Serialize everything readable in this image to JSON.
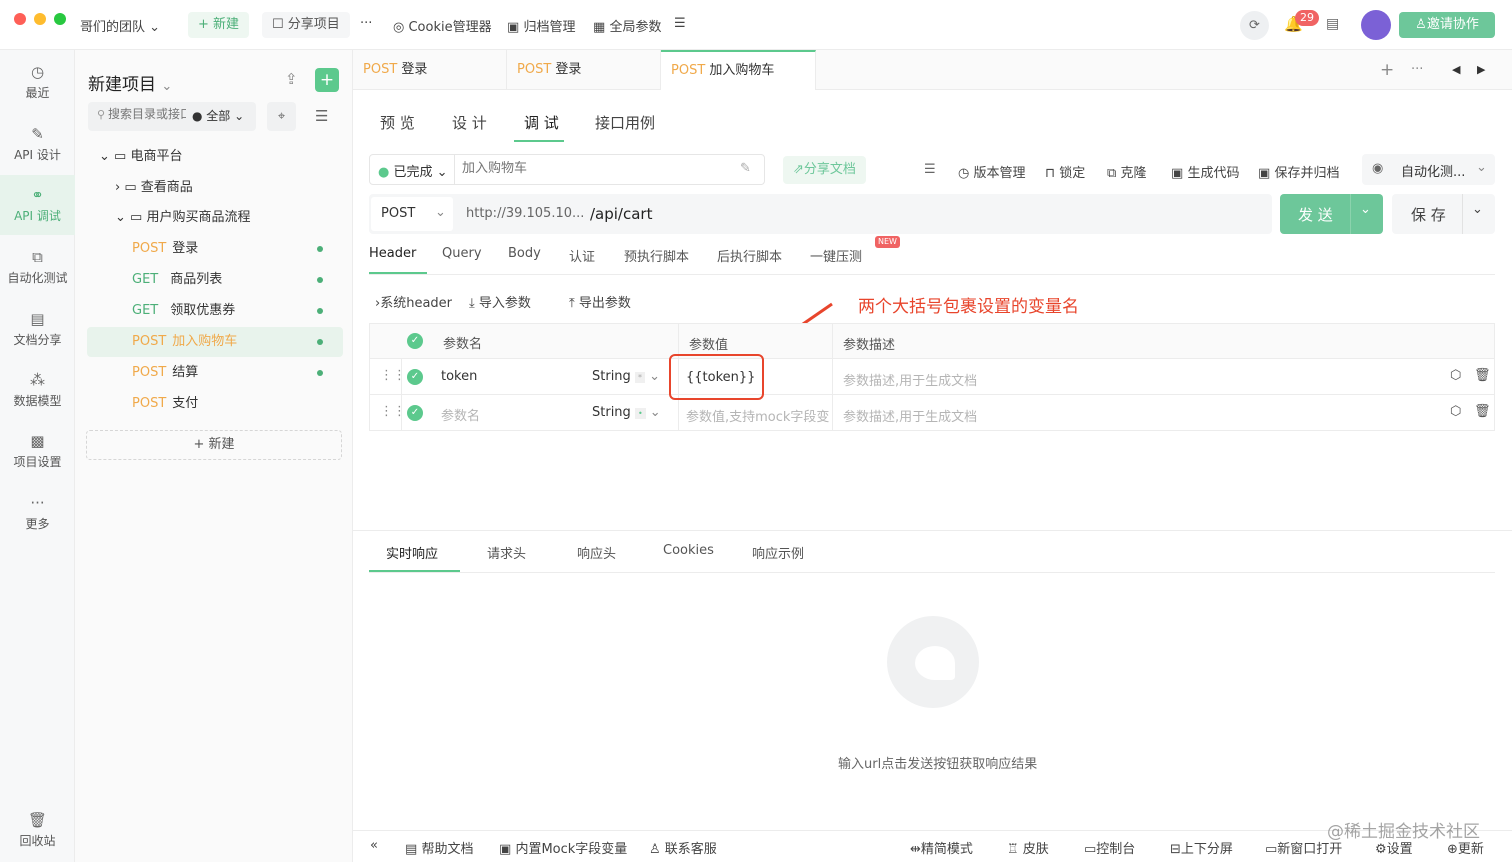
{
  "topbar": {
    "team": "哥们的团队",
    "new": "新建",
    "share_project": "分享项目",
    "more": "···",
    "cookie": "Cookie管理器",
    "archive": "归档管理",
    "global_params": "全局参数",
    "notif_count": "29",
    "invite": "邀请协作"
  },
  "nav": {
    "recent": "最近",
    "api_design": "API 设计",
    "api_debug": "API 调试",
    "auto_test": "自动化测试",
    "doc_share": "文档分享",
    "data_model": "数据模型",
    "project_settings": "项目设置",
    "more": "更多",
    "trash": "回收站"
  },
  "tree": {
    "project": "新建项目",
    "search_placeholder": "搜索目录或接口",
    "filter": "全部",
    "root": "电商平台",
    "folder1": "查看商品",
    "folder2": "用户购买商品流程",
    "items": [
      {
        "method": "POST",
        "name": "登录"
      },
      {
        "method": "GET",
        "name": "商品列表"
      },
      {
        "method": "GET",
        "name": "领取优惠券"
      },
      {
        "method": "POST",
        "name": "加入购物车"
      },
      {
        "method": "POST",
        "name": "结算"
      },
      {
        "method": "POST",
        "name": "支付"
      }
    ],
    "new_button": "新建"
  },
  "tabs": [
    {
      "method": "POST",
      "name": "登录"
    },
    {
      "method": "POST",
      "name": "登录"
    },
    {
      "method": "POST",
      "name": "加入购物车"
    }
  ],
  "subtabs": {
    "preview": "预 览",
    "design": "设 计",
    "debug": "调 试",
    "cases": "接口用例"
  },
  "toolbar": {
    "status": "已完成",
    "name_placeholder": "加入购物车",
    "share_doc": "分享文档",
    "version": "版本管理",
    "lock": "锁定",
    "clone": "克隆",
    "gen_code": "生成代码",
    "save_archive": "保存并归档",
    "auto": "自动化测..."
  },
  "request": {
    "method": "POST",
    "base_url": "http://39.105.10...",
    "path": "/api/cart",
    "send": "发 送",
    "save": "保 存"
  },
  "reqtabs": {
    "header": "Header",
    "query": "Query",
    "body": "Body",
    "auth": "认证",
    "pre": "预执行脚本",
    "post": "后执行脚本",
    "stress": "一键压测",
    "new_badge": "NEW"
  },
  "params_toolbar": {
    "sys_header": "系统header",
    "import": "导入参数",
    "export": "导出参数"
  },
  "annotation": "两个大括号包裹设置的变量名",
  "table": {
    "col_name": "参数名",
    "col_value": "参数值",
    "col_desc": "参数描述",
    "rows": [
      {
        "name": "token",
        "type": "String",
        "value": "{{token}}",
        "desc_placeholder": "参数描述,用于生成文档"
      }
    ],
    "new_row": {
      "name_placeholder": "参数名",
      "type": "String",
      "value_placeholder": "参数值,支持mock字段变量",
      "desc_placeholder": "参数描述,用于生成文档"
    }
  },
  "response": {
    "realtime": "实时响应",
    "req_headers": "请求头",
    "resp_headers": "响应头",
    "cookies": "Cookies",
    "examples": "响应示例",
    "empty_hint": "输入url点击发送按钮获取响应结果"
  },
  "bottombar": {
    "help": "帮助文档",
    "mock": "内置Mock字段变量",
    "support": "联系客服",
    "simple": "精简模式",
    "skin": "皮肤",
    "console": "控制台",
    "split": "上下分屏",
    "new_window": "新窗口打开",
    "settings": "设置",
    "update": "更新"
  },
  "watermark": "@稀土掘金技术社区"
}
